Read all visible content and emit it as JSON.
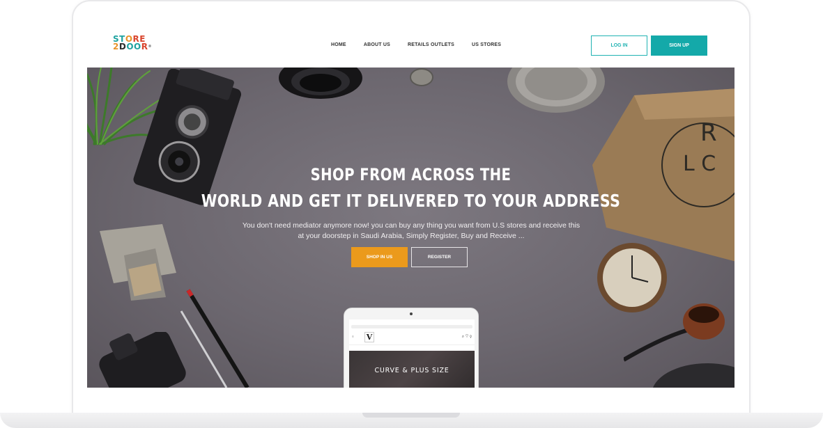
{
  "logo": {
    "line1": [
      "ST",
      "O",
      "RE"
    ],
    "line2": [
      "2",
      "D",
      "OO",
      "R"
    ],
    "registered": "®",
    "colors": {
      "teal": "#1fa3a0",
      "orange": "#e8922a",
      "red": "#d9452d",
      "dark": "#2c2c2c"
    }
  },
  "nav": {
    "items": [
      "HOME",
      "ABOUT US",
      "RETAILS OUTLETS",
      "US STORES"
    ],
    "login_label": "LOG IN",
    "signup_label": "SIGN UP"
  },
  "hero": {
    "title_line1": "SHOP FROM ACROSS THE",
    "title_line2": "WORLD AND GET IT DELIVERED  TO YOUR ADDRESS",
    "subtitle_line1": "You don't need mediator anymore now! you can buy any thing you want from U.S stores and receive this",
    "subtitle_line2": "at your doorstep in Saudi Arabia, Simply Register, Buy and Receive ...",
    "shop_label": "SHOP IN US",
    "register_label": "REGISTER"
  },
  "tablet": {
    "banner_text": "CURVE & PLUS SIZE",
    "logo_letter": "V"
  },
  "colors": {
    "accent_teal": "#14a9a9",
    "accent_orange": "#eb9a1c",
    "hero_bg": "#726d75"
  }
}
